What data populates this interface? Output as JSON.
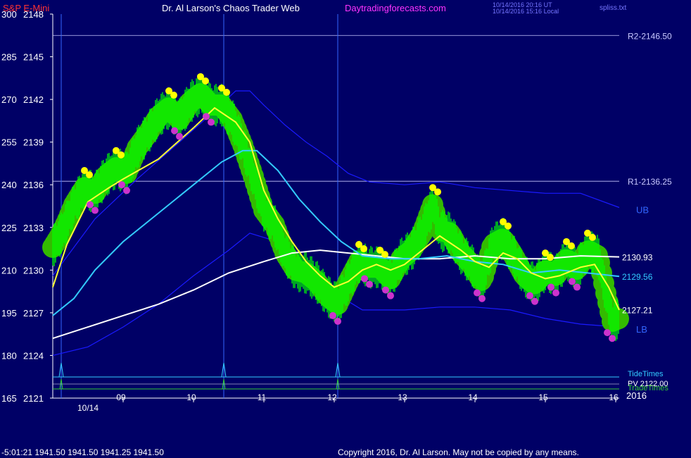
{
  "header": {
    "instrument": "S&P E-Mini",
    "title": "Dr. Al Larson's Chaos Trader Web",
    "site": "Daytradingforecasts.com",
    "time_utc": "10/14/2016 20:16 UT",
    "time_local": "10/14/2016 15:16 Local",
    "file": "spliss.txt"
  },
  "footer": {
    "status": "-5:01:21  1941.50 1941.50 1941.25 1941.50",
    "copyright": "Copyright 2016, Dr. Al Larson. May not be copied by any means."
  },
  "colors": {
    "background": "#000066",
    "price_bar": "#00ff00",
    "halo": "#33bb00",
    "yellow_dot": "#ffff00",
    "magenta_dot": "#cc33cc",
    "band": "#1a1aff",
    "cyan_ma": "#33ccff",
    "white_ma": "#ffffff",
    "yellow_ma": "#ffff33"
  },
  "chart_data": {
    "type": "line",
    "title": "S&P E-Mini",
    "date_label": "10/14",
    "year_label": "2016",
    "x_ticks": [
      "09",
      "10",
      "11",
      "12",
      "13",
      "14",
      "15",
      "16"
    ],
    "x_tick_hours": [
      9,
      10,
      11,
      12,
      13,
      14,
      15,
      16
    ],
    "xlim": [
      8.0,
      16.05
    ],
    "y_ticks": [
      {
        "left": "300",
        "price": "2148",
        "value": 2148
      },
      {
        "left": "285",
        "price": "2145",
        "value": 2145
      },
      {
        "left": "270",
        "price": "2142",
        "value": 2142
      },
      {
        "left": "255",
        "price": "2139",
        "value": 2139
      },
      {
        "left": "240",
        "price": "2136",
        "value": 2136
      },
      {
        "left": "225",
        "price": "2133",
        "value": 2133
      },
      {
        "left": "210",
        "price": "2130",
        "value": 2130
      },
      {
        "left": "195",
        "price": "2127",
        "value": 2127
      },
      {
        "left": "180",
        "price": "2124",
        "value": 2124
      },
      {
        "left": "165",
        "price": "2121",
        "value": 2121
      }
    ],
    "ylim": [
      2121,
      2148
    ],
    "levels": [
      {
        "name": "R2-2146.50",
        "value": 2146.5
      },
      {
        "name": "R1-2136.25",
        "value": 2136.25
      }
    ],
    "right_labels": {
      "ub": "UB",
      "lb": "LB",
      "white_ma": "2130.93",
      "cyan_ma": "2129.56",
      "yellow_ma": "2127.21",
      "tide_times": "TideTimes",
      "pv": "PV 2122.00",
      "trade_times": "TradeTimes"
    },
    "vertical_markers_hours": [
      8.12,
      10.43,
      12.05
    ],
    "series": [
      {
        "name": "price",
        "x": [
          8.0,
          8.1,
          8.2,
          8.3,
          8.45,
          8.6,
          8.75,
          8.9,
          9.05,
          9.2,
          9.35,
          9.5,
          9.65,
          9.8,
          9.95,
          10.1,
          10.25,
          10.4,
          10.55,
          10.7,
          10.85,
          11.0,
          11.15,
          11.3,
          11.45,
          11.6,
          11.75,
          11.9,
          12.05,
          12.2,
          12.35,
          12.5,
          12.65,
          12.8,
          12.95,
          13.1,
          13.25,
          13.4,
          13.5,
          13.65,
          13.8,
          13.95,
          14.1,
          14.25,
          14.4,
          14.55,
          14.7,
          14.85,
          15.0,
          15.15,
          15.3,
          15.45,
          15.6,
          15.75,
          15.85,
          15.95,
          16.05
        ],
        "y": [
          2131.6,
          2132.4,
          2133.4,
          2134.6,
          2135.8,
          2135.4,
          2136.6,
          2137.2,
          2136.8,
          2138.6,
          2139.6,
          2140.8,
          2141.4,
          2140.6,
          2141.8,
          2142.4,
          2141.6,
          2141.6,
          2140.6,
          2138.8,
          2136.6,
          2134.2,
          2133.2,
          2131.2,
          2130.0,
          2129.8,
          2129.2,
          2128.2,
          2127.6,
          2129.2,
          2130.6,
          2130.2,
          2130.2,
          2129.4,
          2130.8,
          2131.4,
          2132.6,
          2134.6,
          2132.8,
          2132.6,
          2131.2,
          2130.4,
          2129.2,
          2131.8,
          2132.2,
          2131.0,
          2129.6,
          2129.0,
          2130.0,
          2129.6,
          2130.8,
          2130.0,
          2131.4,
          2131.0,
          2128.6,
          2126.4,
          2126.6
        ]
      },
      {
        "name": "yellow_ma",
        "x": [
          8.0,
          8.2,
          8.5,
          8.8,
          9.0,
          9.5,
          10.0,
          10.3,
          10.6,
          10.8,
          11.0,
          11.2,
          11.4,
          11.6,
          11.8,
          12.0,
          12.2,
          12.4,
          12.6,
          12.8,
          13.0,
          13.2,
          13.5,
          13.8,
          14.0,
          14.2,
          14.4,
          14.6,
          14.8,
          15.0,
          15.2,
          15.5,
          15.7,
          15.9,
          16.05
        ],
        "y": [
          2128.8,
          2131.8,
          2134.8,
          2135.8,
          2136.4,
          2137.8,
          2140.0,
          2141.4,
          2140.4,
          2139.0,
          2135.6,
          2133.6,
          2132.0,
          2130.6,
          2129.6,
          2128.8,
          2129.2,
          2130.0,
          2130.4,
          2130.0,
          2130.4,
          2131.2,
          2132.4,
          2131.4,
          2130.6,
          2130.2,
          2131.2,
          2130.8,
          2129.8,
          2129.4,
          2129.6,
          2130.2,
          2130.4,
          2128.8,
          2127.2
        ]
      },
      {
        "name": "cyan_ma",
        "x": [
          8.0,
          8.3,
          8.6,
          9.0,
          9.5,
          10.0,
          10.4,
          10.7,
          10.9,
          11.2,
          11.5,
          11.8,
          12.1,
          12.4,
          12.8,
          13.2,
          13.6,
          14.0,
          14.4,
          14.8,
          15.2,
          15.6,
          16.05
        ],
        "y": [
          2126.8,
          2128.0,
          2130.0,
          2132.0,
          2134.0,
          2136.0,
          2137.6,
          2138.4,
          2138.4,
          2137.0,
          2135.0,
          2133.4,
          2132.0,
          2131.0,
          2130.8,
          2130.8,
          2131.0,
          2130.6,
          2130.4,
          2129.8,
          2130.0,
          2129.8,
          2129.56
        ]
      },
      {
        "name": "white_ma",
        "x": [
          8.0,
          8.5,
          9.0,
          9.5,
          10.0,
          10.5,
          11.0,
          11.4,
          11.8,
          12.2,
          12.6,
          13.0,
          13.5,
          14.0,
          14.5,
          15.0,
          15.5,
          16.05
        ],
        "y": [
          2125.2,
          2126.0,
          2126.8,
          2127.6,
          2128.6,
          2129.8,
          2130.6,
          2131.2,
          2131.4,
          2131.2,
          2131.0,
          2130.8,
          2130.8,
          2131.0,
          2130.8,
          2130.8,
          2131.0,
          2130.93
        ]
      },
      {
        "name": "upper_band",
        "x": [
          8.0,
          8.6,
          9.2,
          9.8,
          10.3,
          10.6,
          10.8,
          11.0,
          11.3,
          11.6,
          11.9,
          12.2,
          12.5,
          13.0,
          13.5,
          14.0,
          14.5,
          15.0,
          15.5,
          16.05
        ],
        "y": [
          2129.6,
          2133.6,
          2136.4,
          2139.0,
          2141.2,
          2142.6,
          2142.6,
          2141.6,
          2140.2,
          2139.0,
          2138.0,
          2136.8,
          2136.2,
          2136.0,
          2136.2,
          2135.8,
          2135.6,
          2135.4,
          2135.4,
          2134.4
        ]
      },
      {
        "name": "lower_band",
        "x": [
          8.0,
          8.5,
          9.0,
          9.5,
          10.0,
          10.5,
          10.8,
          11.2,
          11.6,
          12.0,
          12.4,
          13.0,
          13.5,
          14.0,
          14.5,
          15.0,
          15.5,
          16.05
        ],
        "y": [
          2124.0,
          2124.6,
          2126.0,
          2127.6,
          2129.6,
          2131.4,
          2132.6,
          2132.0,
          2130.4,
          2128.4,
          2127.2,
          2127.2,
          2127.4,
          2127.4,
          2127.2,
          2126.6,
          2126.2,
          2126.0
        ]
      }
    ]
  }
}
